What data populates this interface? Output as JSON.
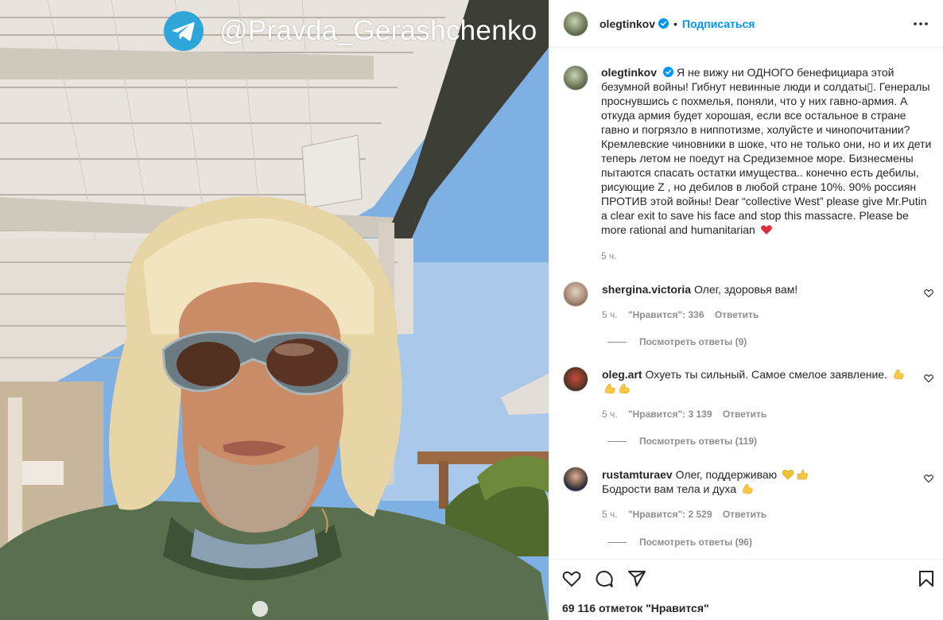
{
  "watermark": {
    "icon": "telegram-icon",
    "handle": "@Pravda_Gerashchenko"
  },
  "header": {
    "username": "olegtinkov",
    "separator": "•",
    "follow_label": "Подписаться",
    "more_icon": "more-horizontal-icon"
  },
  "caption": {
    "username": "olegtinkov",
    "text": "Я не вижу ни ОДНОГО бенефициара этой безумной войны! Гибнут невинные люди и солдаты▯. Генералы проснувшись с похмелья, поняли, что у них гавно-армия. А откуда армия будет хорошая, если все остальное в стране гавно и погрязло в ниппотизме, холуйсте и чинопочитании? Кремлевские чиновники в шоке, что не только они, но и их дети теперь летом не поедут на Средиземное море. Бизнесмены пытаются спасать остатки имущества.. конечно есть дебилы, рисующие Z , но дебилов в любой стране 10%. 90% россиян ПРОТИВ этой войны! Dear “collective West” please give Mr.Putin a clear exit to save his face and stop this massacre. Please be more rational and humanitarian",
    "emoji": "red-heart-icon",
    "time": "5 ч."
  },
  "comments": [
    {
      "username": "shergina.victoria",
      "text": "Олег, здоровья вам!",
      "time": "5 ч.",
      "likes": "\"Нравится\": 336",
      "reply": "Ответить",
      "view_replies": "Посмотреть ответы (9)"
    },
    {
      "username": "oleg.art",
      "text": "Охуеть ты сильный. Самое смелое заявление.",
      "emoji": "flexed-biceps-icon",
      "time": "5 ч.",
      "likes": "\"Нравится\": 3 139",
      "reply": "Ответить",
      "view_replies": "Посмотреть ответы (119)"
    },
    {
      "username": "rustamturaev",
      "text": "Олег, поддерживаю",
      "text2": "Бодрости вам тела и духа",
      "emoji": "heart-thumbs-up-icon",
      "time": "5 ч.",
      "likes": "\"Нравится\": 2 529",
      "reply": "Ответить",
      "view_replies": "Посмотреть ответы (96)"
    }
  ],
  "actions": {
    "icons": [
      "heart-icon",
      "comment-icon",
      "share-icon",
      "bookmark-icon"
    ],
    "likes_total": "69 116 отметок \"Нравится\""
  },
  "colors": {
    "accent": "#0095f6",
    "verified": "#0095f6",
    "muted": "#8e8e8e",
    "heart": "#ed4956"
  }
}
